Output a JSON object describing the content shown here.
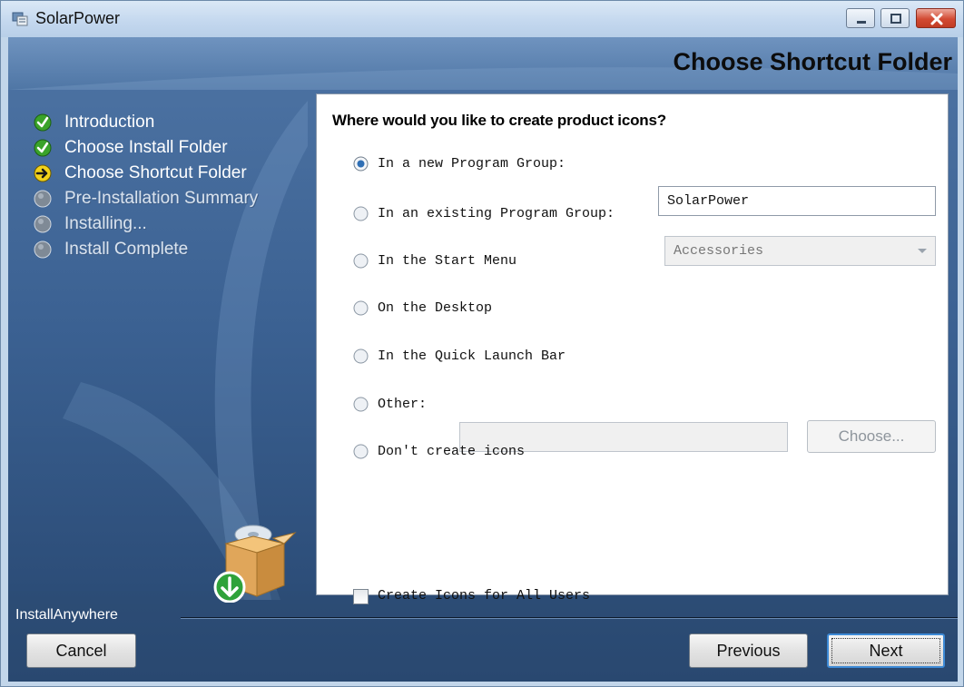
{
  "window": {
    "title": "SolarPower"
  },
  "header": {
    "title": "Choose Shortcut Folder"
  },
  "steps": [
    {
      "label": "Introduction",
      "state": "done"
    },
    {
      "label": "Choose Install Folder",
      "state": "done"
    },
    {
      "label": "Choose Shortcut Folder",
      "state": "current"
    },
    {
      "label": "Pre-Installation Summary",
      "state": "pending"
    },
    {
      "label": "Installing...",
      "state": "pending"
    },
    {
      "label": "Install Complete",
      "state": "pending"
    }
  ],
  "content": {
    "question": "Where would you like to create product icons?",
    "options": {
      "new_group": {
        "label": "In a new Program Group:",
        "selected": true,
        "value": "SolarPower"
      },
      "existing_group": {
        "label": "In an existing Program Group:",
        "selected": false,
        "value": "Accessories"
      },
      "start_menu": {
        "label": "In the Start Menu",
        "selected": false
      },
      "desktop": {
        "label": "On the Desktop",
        "selected": false
      },
      "quick_launch": {
        "label": "In the Quick Launch Bar",
        "selected": false
      },
      "other": {
        "label": "Other:",
        "selected": false,
        "value": ""
      },
      "none": {
        "label": "Don't create icons",
        "selected": false
      }
    },
    "choose_button": "Choose...",
    "all_users": {
      "label": "Create Icons for All Users",
      "checked": false
    }
  },
  "footer": {
    "brand": "InstallAnywhere",
    "cancel": "Cancel",
    "previous": "Previous",
    "next": "Next"
  },
  "colors": {
    "panel_dark": "#1f3f68",
    "panel_mid": "#5d82b0",
    "done_green": "#3aa32a",
    "current_yellow": "#f2d21a",
    "pending_gray": "#7f8a96",
    "close_red": "#c73b24"
  },
  "icons": {
    "done": "check-circle-icon",
    "current": "arrow-right-circle-icon",
    "pending": "gray-circle-icon"
  }
}
